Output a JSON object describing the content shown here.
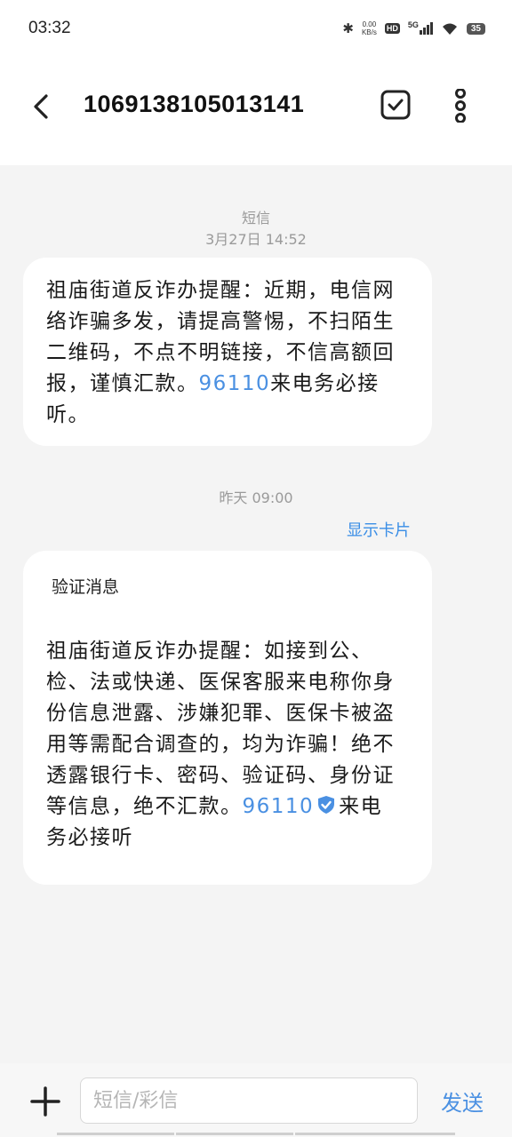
{
  "status_bar": {
    "time": "03:32",
    "net_speed_value": "0.00",
    "net_speed_unit": "KB/s",
    "hd_label": "HD",
    "network_label": "5G",
    "battery": "35"
  },
  "header": {
    "title": "1069138105013141",
    "back_icon": "chevron-left-icon",
    "select_icon": "checkbox-icon",
    "more_icon": "more-vertical-icon"
  },
  "thread": {
    "messages": [
      {
        "type_label": "短信",
        "timestamp": "3月27日 14:52",
        "text_before": "祖庙街道反诈办提醒：近期，电信网\n络诈骗多发，请提高警惕，不扫陌生\n二维码，不点不明链接，不信高额回\n报，谨慎汇款。",
        "phone": "96110",
        "text_after": "来电务必接\n听。"
      },
      {
        "timestamp": "昨天 09:00",
        "card_toggle": "显示卡片",
        "title": "验证消息",
        "text_before": "祖庙街道反诈办提醒：如接到公、\n检、法或快递、医保客服来电称你身\n份信息泄露、涉嫌犯罪、医保卡被盗\n用等需配合调查的，均为诈骗！绝不\n透露银行卡、密码、验证码、身份证\n等信息，绝不汇款。",
        "phone": "96110",
        "verified_icon": "verified-shield-icon",
        "text_after": "来电\n务必接听"
      }
    ]
  },
  "composer": {
    "add_icon": "plus-icon",
    "placeholder": "短信/彩信",
    "send_label": "发送"
  },
  "colors": {
    "accent": "#4a90e2",
    "background": "#f4f4f4",
    "bubble": "#ffffff"
  }
}
